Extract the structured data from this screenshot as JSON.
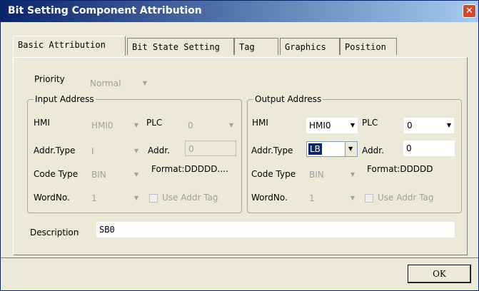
{
  "window": {
    "title": "Bit Setting Component Attribution",
    "close_glyph": "✕"
  },
  "tabs": [
    {
      "label": "Basic Attribution"
    },
    {
      "label": "Bit State Setting"
    },
    {
      "label": "Tag"
    },
    {
      "label": "Graphics"
    },
    {
      "label": "Position"
    }
  ],
  "priority": {
    "label": "Priority",
    "value": "Normal"
  },
  "input_address": {
    "title": "Input Address",
    "hmi_label": "HMI",
    "hmi_value": "HMI0",
    "plc_label": "PLC",
    "plc_value": "0",
    "addr_type_label": "Addr.Type",
    "addr_type_value": "I",
    "addr_label": "Addr.",
    "addr_value": "0",
    "code_type_label": "Code Type",
    "code_type_value": "BIN",
    "format_text": "Format:DDDDD....",
    "word_no_label": "WordNo.",
    "word_no_value": "1",
    "use_addr_tag_label": "Use Addr Tag"
  },
  "output_address": {
    "title": "Output Address",
    "hmi_label": "HMI",
    "hmi_value": "HMI0",
    "plc_label": "PLC",
    "plc_value": "0",
    "addr_type_label": "Addr.Type",
    "addr_type_value": "LB",
    "addr_label": "Addr.",
    "addr_value": "0",
    "code_type_label": "Code Type",
    "code_type_value": "BIN",
    "format_text": "Format:DDDDD",
    "word_no_label": "WordNo.",
    "word_no_value": "1",
    "use_addr_tag_label": "Use Addr Tag"
  },
  "description": {
    "label": "Description",
    "value": "SB0"
  },
  "footer": {
    "ok_label": "OK"
  },
  "colors": {
    "title_start": "#0a246a",
    "title_end": "#a6caf0",
    "dialog_bg": "#ece9d8",
    "close_red": "#d4482c",
    "selection": "#0a246a"
  },
  "icons": {
    "close": "close-icon",
    "dropdown": "chevron-down-icon"
  }
}
